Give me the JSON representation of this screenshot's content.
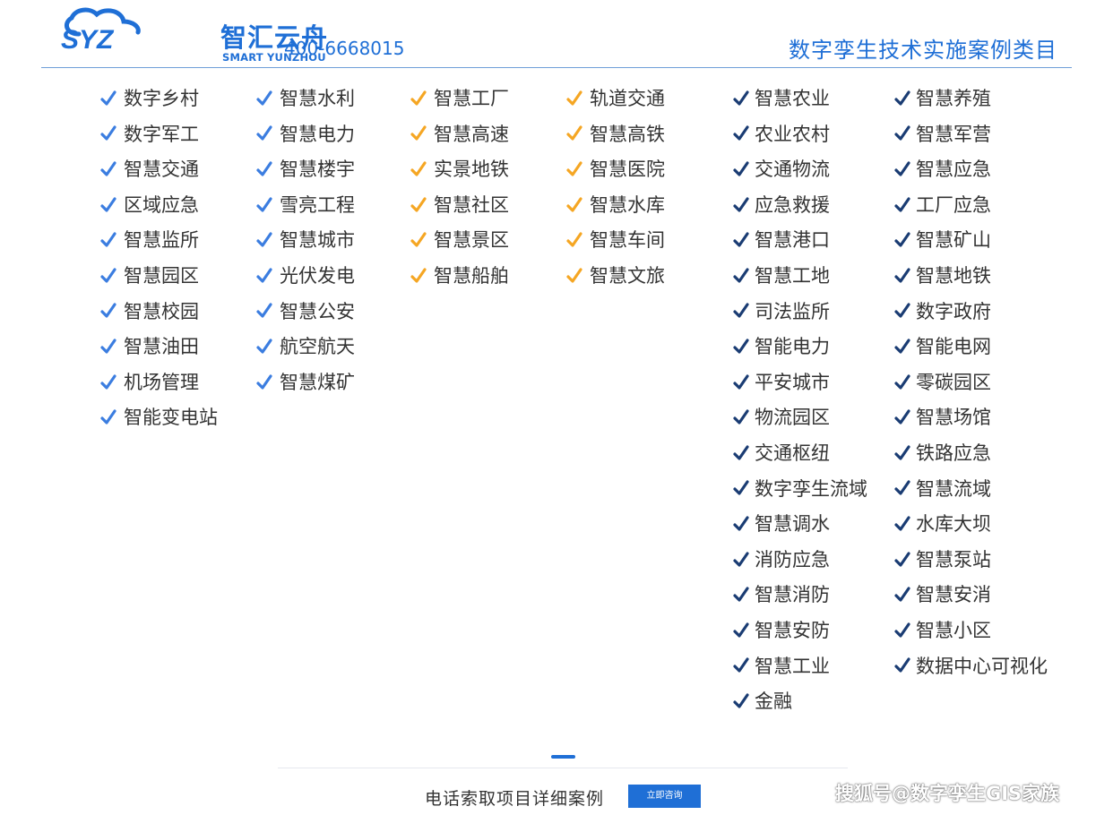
{
  "header": {
    "logo_mark": "SYZ",
    "logo_cn": "智汇云舟",
    "logo_en": "SMART YUNZHOU",
    "phone": "400-6668015",
    "title": "数字孪生技术实施案例类目"
  },
  "colors": {
    "blue": "#3b7de0",
    "orange": "#f5a623",
    "navy": "#1a3c73",
    "brand": "#1f6fd6"
  },
  "icons": {
    "check": "check-icon"
  },
  "columns": [
    {
      "color": "blue",
      "items": [
        "数字乡村",
        "数字军工",
        "智慧交通",
        "区域应急",
        "智慧监所",
        "智慧园区",
        "智慧校园",
        "智慧油田",
        "机场管理",
        "智能变电站"
      ]
    },
    {
      "color": "blue",
      "items": [
        "智慧水利",
        "智慧电力",
        "智慧楼宇",
        "雪亮工程",
        "智慧城市",
        "光伏发电",
        "智慧公安",
        "航空航天",
        "智慧煤矿"
      ]
    },
    {
      "color": "orange",
      "items": [
        "智慧工厂",
        "智慧高速",
        "实景地铁",
        "智慧社区",
        "智慧景区",
        "智慧船舶"
      ]
    },
    {
      "color": "orange",
      "items": [
        "轨道交通",
        "智慧高铁",
        "智慧医院",
        "智慧水库",
        "智慧车间",
        "智慧文旅"
      ]
    },
    {
      "color": "navy",
      "items": [
        "智慧农业",
        "农业农村",
        "交通物流",
        "应急救援",
        "智慧港口",
        "智慧工地",
        "司法监所",
        "智能电力",
        "平安城市",
        "物流园区",
        "交通枢纽",
        "数字孪生流域",
        "智慧调水",
        "消防应急",
        "智慧消防",
        "智慧安防",
        "智慧工业",
        "金融"
      ]
    },
    {
      "color": "navy",
      "items": [
        "智慧养殖",
        "智慧军营",
        "智慧应急",
        "工厂应急",
        "智慧矿山",
        "智慧地铁",
        "数字政府",
        "智能电网",
        "零碳园区",
        "智慧场馆",
        "铁路应急",
        "智慧流域",
        "水库大坝",
        "智慧泵站",
        "智慧安消",
        "智慧小区",
        "数据中心可视化"
      ]
    }
  ],
  "footer": {
    "text": "电话索取项目详细案例",
    "button": "立即咨询"
  },
  "watermark": "搜狐号@数字孪生GIS家族"
}
